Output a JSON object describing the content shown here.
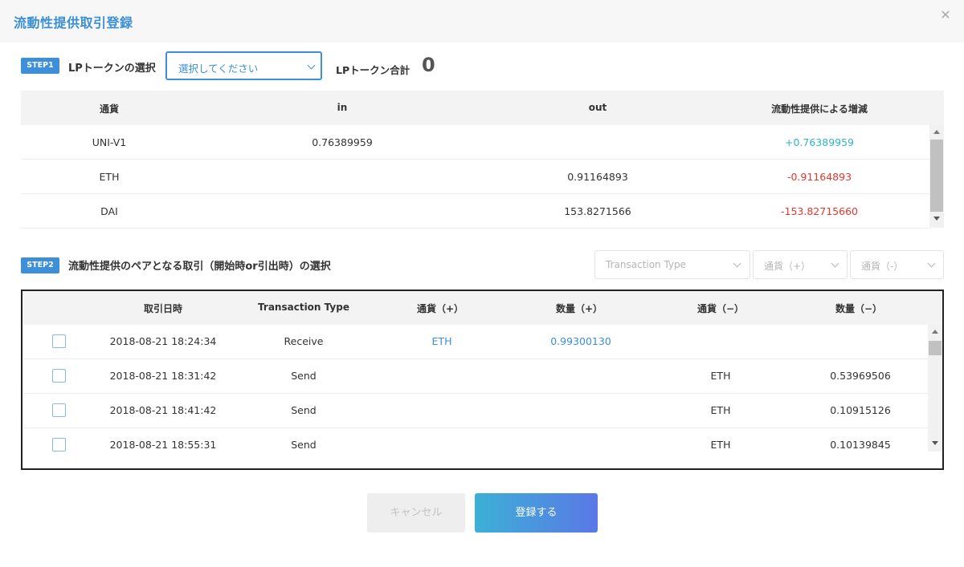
{
  "modal": {
    "title": "流動性提供取引登録",
    "close_glyph": "✕"
  },
  "step1": {
    "badge": "STEP1",
    "label": "LPトークンの選択",
    "select_placeholder": "選択してください",
    "total_label": "LPトークン合計",
    "total_value": "0"
  },
  "table1": {
    "headers": {
      "currency": "通貨",
      "in": "in",
      "out": "out",
      "change": "流動性提供による増減"
    },
    "rows": [
      {
        "currency": "UNI-V1",
        "in": "0.76389959",
        "out": "",
        "change": "+0.76389959"
      },
      {
        "currency": "ETH",
        "in": "",
        "out": "0.91164893",
        "change": "-0.91164893"
      },
      {
        "currency": "DAI",
        "in": "",
        "out": "153.8271566",
        "change": "-153.82715660"
      }
    ]
  },
  "step2": {
    "badge": "STEP2",
    "label": "流動性提供のペアとなる取引（開始時or引出時）の選択",
    "filters": {
      "transaction_type": "Transaction Type",
      "currency_plus": "通貨（+）",
      "currency_minus": "通貨（-）"
    }
  },
  "table2": {
    "headers": {
      "datetime": "取引日時",
      "type": "Transaction Type",
      "currency_plus": "通貨（+）",
      "amount_plus": "数量（+）",
      "currency_minus": "通貨（−）",
      "amount_minus": "数量（−）"
    },
    "rows": [
      {
        "datetime": "2018-08-21 18:24:34",
        "type": "Receive",
        "currency_plus": "ETH",
        "amount_plus": "0.99300130",
        "currency_minus": "",
        "amount_minus": ""
      },
      {
        "datetime": "2018-08-21 18:31:42",
        "type": "Send",
        "currency_plus": "",
        "amount_plus": "",
        "currency_minus": "ETH",
        "amount_minus": "0.53969506"
      },
      {
        "datetime": "2018-08-21 18:41:42",
        "type": "Send",
        "currency_plus": "",
        "amount_plus": "",
        "currency_minus": "ETH",
        "amount_minus": "0.10915126"
      },
      {
        "datetime": "2018-08-21 18:55:31",
        "type": "Send",
        "currency_plus": "",
        "amount_plus": "",
        "currency_minus": "ETH",
        "amount_minus": "0.10139845"
      }
    ]
  },
  "buttons": {
    "cancel": "キャンセル",
    "submit": "登録する"
  },
  "colors": {
    "accent": "#3d8fd8",
    "positive": "#2fb5c8",
    "negative": "#e8352e"
  }
}
